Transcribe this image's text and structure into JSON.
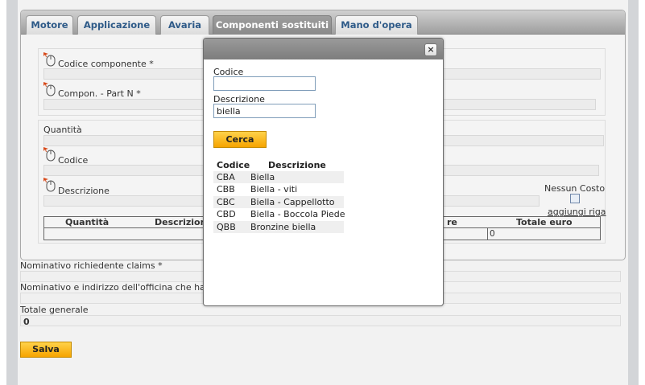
{
  "tabs": [
    {
      "label": "Motore"
    },
    {
      "label": "Applicazione"
    },
    {
      "label": "Avaria"
    },
    {
      "label": "Componenti sostituiti"
    },
    {
      "label": "Mano d'opera"
    }
  ],
  "active_tab": "Componenti sostituiti",
  "form": {
    "codice_componente_label": "Codice componente *",
    "compon_part_label": "Compon. - Part N *",
    "quantita_label": "Quantità",
    "codice_label": "Codice",
    "descrizione_label": "Descrizione",
    "nessun_costo_label": "Nessun Costo",
    "aggiungi_riga_label": "aggiungi riga",
    "grid": {
      "headers": [
        "Quantità",
        "Descrizione",
        "re",
        "Totale euro"
      ],
      "row_total": "0"
    }
  },
  "bottom": {
    "nominativo_richiedente_label": "Nominativo richiedente claims *",
    "nominativo_officina_label": "Nominativo e indirizzo dell'officina che ha e",
    "totale_generale_label": "Totale generale",
    "totale_generale_value": "0",
    "salva_label": "Salva"
  },
  "modal": {
    "close_label": "×",
    "codice_label": "Codice",
    "codice_value": "",
    "descrizione_label": "Descrizione",
    "descrizione_value": "biella",
    "cerca_label": "Cerca",
    "results": {
      "headers": [
        "Codice",
        "Descrizione"
      ],
      "rows": [
        {
          "codice": "CBA",
          "descrizione": "Biella"
        },
        {
          "codice": "CBB",
          "descrizione": "Biella - viti"
        },
        {
          "codice": "CBC",
          "descrizione": "Biella - Cappellotto"
        },
        {
          "codice": "CBD",
          "descrizione": "Biella - Boccola Piede"
        },
        {
          "codice": "QBB",
          "descrizione": "Bronzine biella"
        }
      ]
    }
  },
  "colors": {
    "tab_text": "#2e5a88",
    "active_tab_bg": "#8f8f8f",
    "button_yellow": "#f6a400",
    "input_border": "#7f9db9"
  },
  "icons": {
    "field_icon": "mouse-icon",
    "close_icon": "close-icon"
  }
}
